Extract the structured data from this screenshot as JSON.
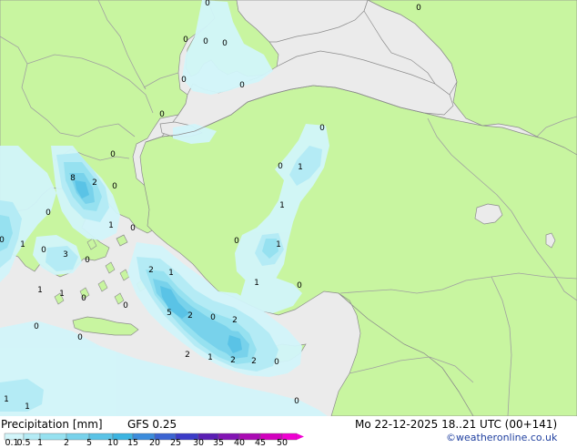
{
  "title": "Precipitation [mm]",
  "model": "GFS 0.25",
  "valid_time": "Mo 22-12-2025 18..21 UTC (00+141)",
  "credit": "©weatheronline.co.uk",
  "colors": {
    "sea": "#ebebeb",
    "land": "#c8f5a0",
    "border": "#a0a0a0",
    "coast": "#8c8c8c",
    "text": "#000000",
    "credit": "#1f3f9f"
  },
  "legend": {
    "ticks": [
      "0.1",
      "0.5",
      "1",
      "2",
      "5",
      "10",
      "15",
      "20",
      "25",
      "30",
      "35",
      "40",
      "45",
      "50"
    ],
    "colors": [
      "#d2f5fa",
      "#b4ebf5",
      "#96e1f0",
      "#78d2eb",
      "#5ac3e6",
      "#3cb4e1",
      "#3c8cdc",
      "#3c64d2",
      "#3c3cc8",
      "#5a1eb4",
      "#8214b4",
      "#aa0ab4",
      "#d200be",
      "#f000d2"
    ]
  },
  "precip_labels": [
    {
      "text": "0"
    },
    {
      "text": "0"
    },
    {
      "text": "0"
    },
    {
      "text": "0"
    },
    {
      "text": "0"
    },
    {
      "text": "0"
    },
    {
      "text": "0"
    },
    {
      "text": "0"
    },
    {
      "text": "0"
    },
    {
      "text": "0"
    },
    {
      "text": "1"
    },
    {
      "text": "0"
    },
    {
      "text": "1"
    },
    {
      "text": "1"
    },
    {
      "text": "0"
    },
    {
      "text": "1"
    },
    {
      "text": "0"
    },
    {
      "text": "8"
    },
    {
      "text": "2"
    },
    {
      "text": "0"
    },
    {
      "text": "0"
    },
    {
      "text": "1"
    },
    {
      "text": "0"
    },
    {
      "text": "0"
    },
    {
      "text": "1"
    },
    {
      "text": "0"
    },
    {
      "text": "3"
    },
    {
      "text": "0"
    },
    {
      "text": "1"
    },
    {
      "text": "1"
    },
    {
      "text": "0"
    },
    {
      "text": "2"
    },
    {
      "text": "1"
    },
    {
      "text": "0"
    },
    {
      "text": "5"
    },
    {
      "text": "2"
    },
    {
      "text": "0"
    },
    {
      "text": "2"
    },
    {
      "text": "0"
    },
    {
      "text": "0"
    },
    {
      "text": "2"
    },
    {
      "text": "1"
    },
    {
      "text": "2"
    },
    {
      "text": "2"
    },
    {
      "text": "0"
    },
    {
      "text": "0"
    },
    {
      "text": "1"
    },
    {
      "text": "1"
    }
  ]
}
